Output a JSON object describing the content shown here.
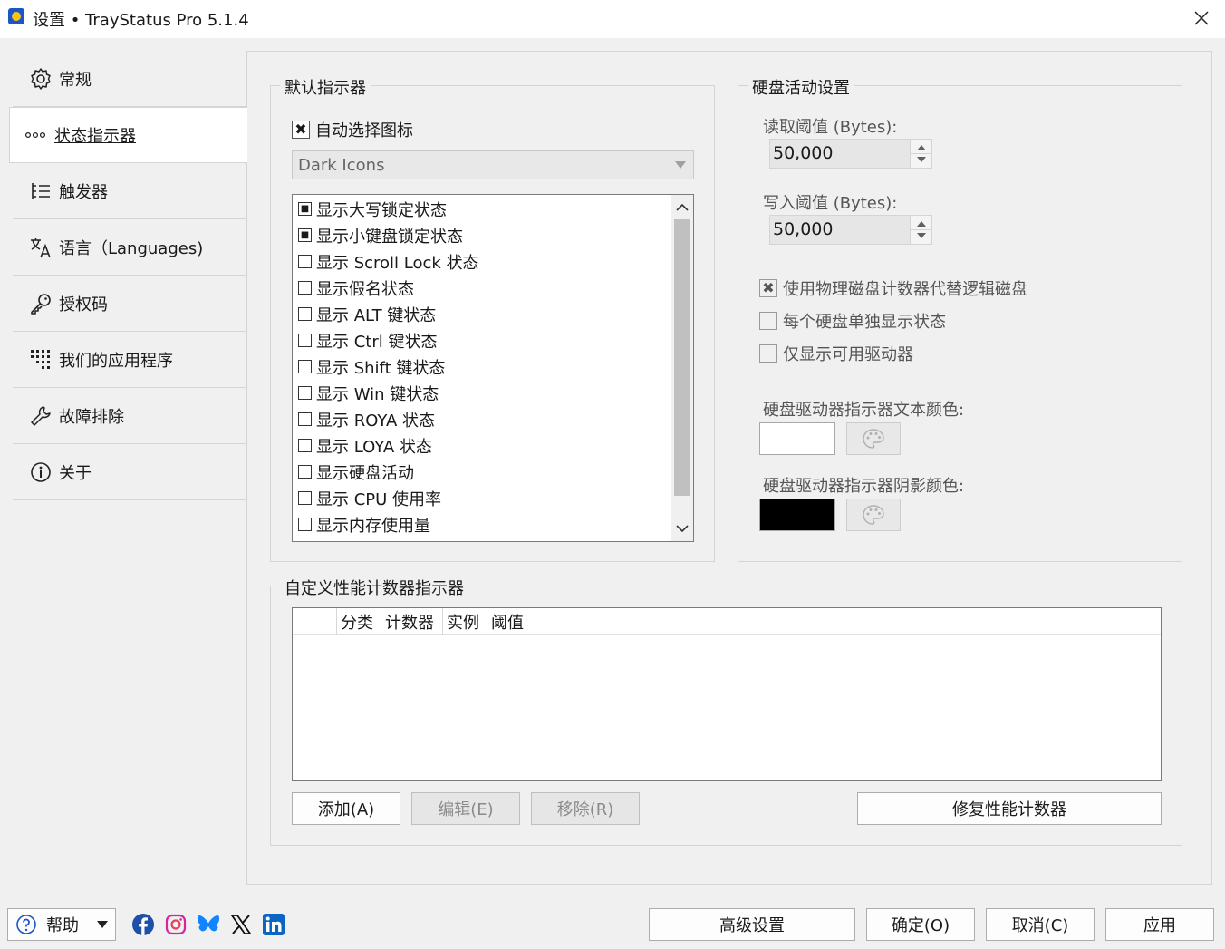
{
  "window": {
    "title": "设置 • TrayStatus Pro 5.1.4"
  },
  "sidebar": {
    "items": [
      {
        "label": "常规",
        "icon": "gear-icon"
      },
      {
        "label": "状态指示器",
        "icon": "dots-icon"
      },
      {
        "label": "触发器",
        "icon": "trigger-list-icon"
      },
      {
        "label": "语言（Languages)",
        "icon": "translate-icon"
      },
      {
        "label": "授权码",
        "icon": "key-icon"
      },
      {
        "label": "我们的应用程序",
        "icon": "apps-grid-icon"
      },
      {
        "label": "故障排除",
        "icon": "wrench-icon"
      },
      {
        "label": "关于",
        "icon": "info-icon"
      }
    ],
    "active_index": 1
  },
  "default_indicators": {
    "title": "默认指示器",
    "auto_select_label": "自动选择图标",
    "auto_select_checked": true,
    "icon_set": "Dark Icons",
    "items": [
      {
        "label": "显示大写锁定状态",
        "checked": true
      },
      {
        "label": "显示小键盘锁定状态",
        "checked": true
      },
      {
        "label": "显示 Scroll Lock 状态",
        "checked": false
      },
      {
        "label": "显示假名状态",
        "checked": false
      },
      {
        "label": "显示 ALT 键状态",
        "checked": false
      },
      {
        "label": "显示 Ctrl 键状态",
        "checked": false
      },
      {
        "label": "显示 Shift 键状态",
        "checked": false
      },
      {
        "label": "显示 Win 键状态",
        "checked": false
      },
      {
        "label": "显示 ROYA 状态",
        "checked": false
      },
      {
        "label": "显示 LOYA 状态",
        "checked": false
      },
      {
        "label": "显示硬盘活动",
        "checked": false
      },
      {
        "label": "显示 CPU 使用率",
        "checked": false
      },
      {
        "label": "显示内存使用量",
        "checked": false
      }
    ]
  },
  "disk": {
    "title": "硬盘活动设置",
    "read_label": "读取阈值 (Bytes):",
    "read_value": "50,000",
    "write_label": "写入阈值 (Bytes):",
    "write_value": "50,000",
    "opt1_label": "使用物理磁盘计数器代替逻辑磁盘",
    "opt1_checked": true,
    "opt2_label": "每个硬盘单独显示状态",
    "opt3_label": "仅显示可用驱动器",
    "text_color_label": "硬盘驱动器指示器文本颜色:",
    "text_color": "#ffffff",
    "shadow_color_label": "硬盘驱动器指示器阴影颜色:",
    "shadow_color": "#000000"
  },
  "custom": {
    "title": "自定义性能计数器指示器",
    "columns": [
      "分类",
      "计数器",
      "实例",
      "阈值"
    ],
    "add_label": "添加(A)",
    "edit_label": "编辑(E)",
    "remove_label": "移除(R)",
    "repair_label": "修复性能计数器"
  },
  "footer": {
    "help_label": "帮助",
    "social": [
      "facebook-icon",
      "instagram-icon",
      "bluesky-icon",
      "x-icon",
      "linkedin-icon"
    ],
    "advanced_label": "高级设置",
    "ok_label": "确定(O)",
    "cancel_label": "取消(C)",
    "apply_label": "应用"
  }
}
